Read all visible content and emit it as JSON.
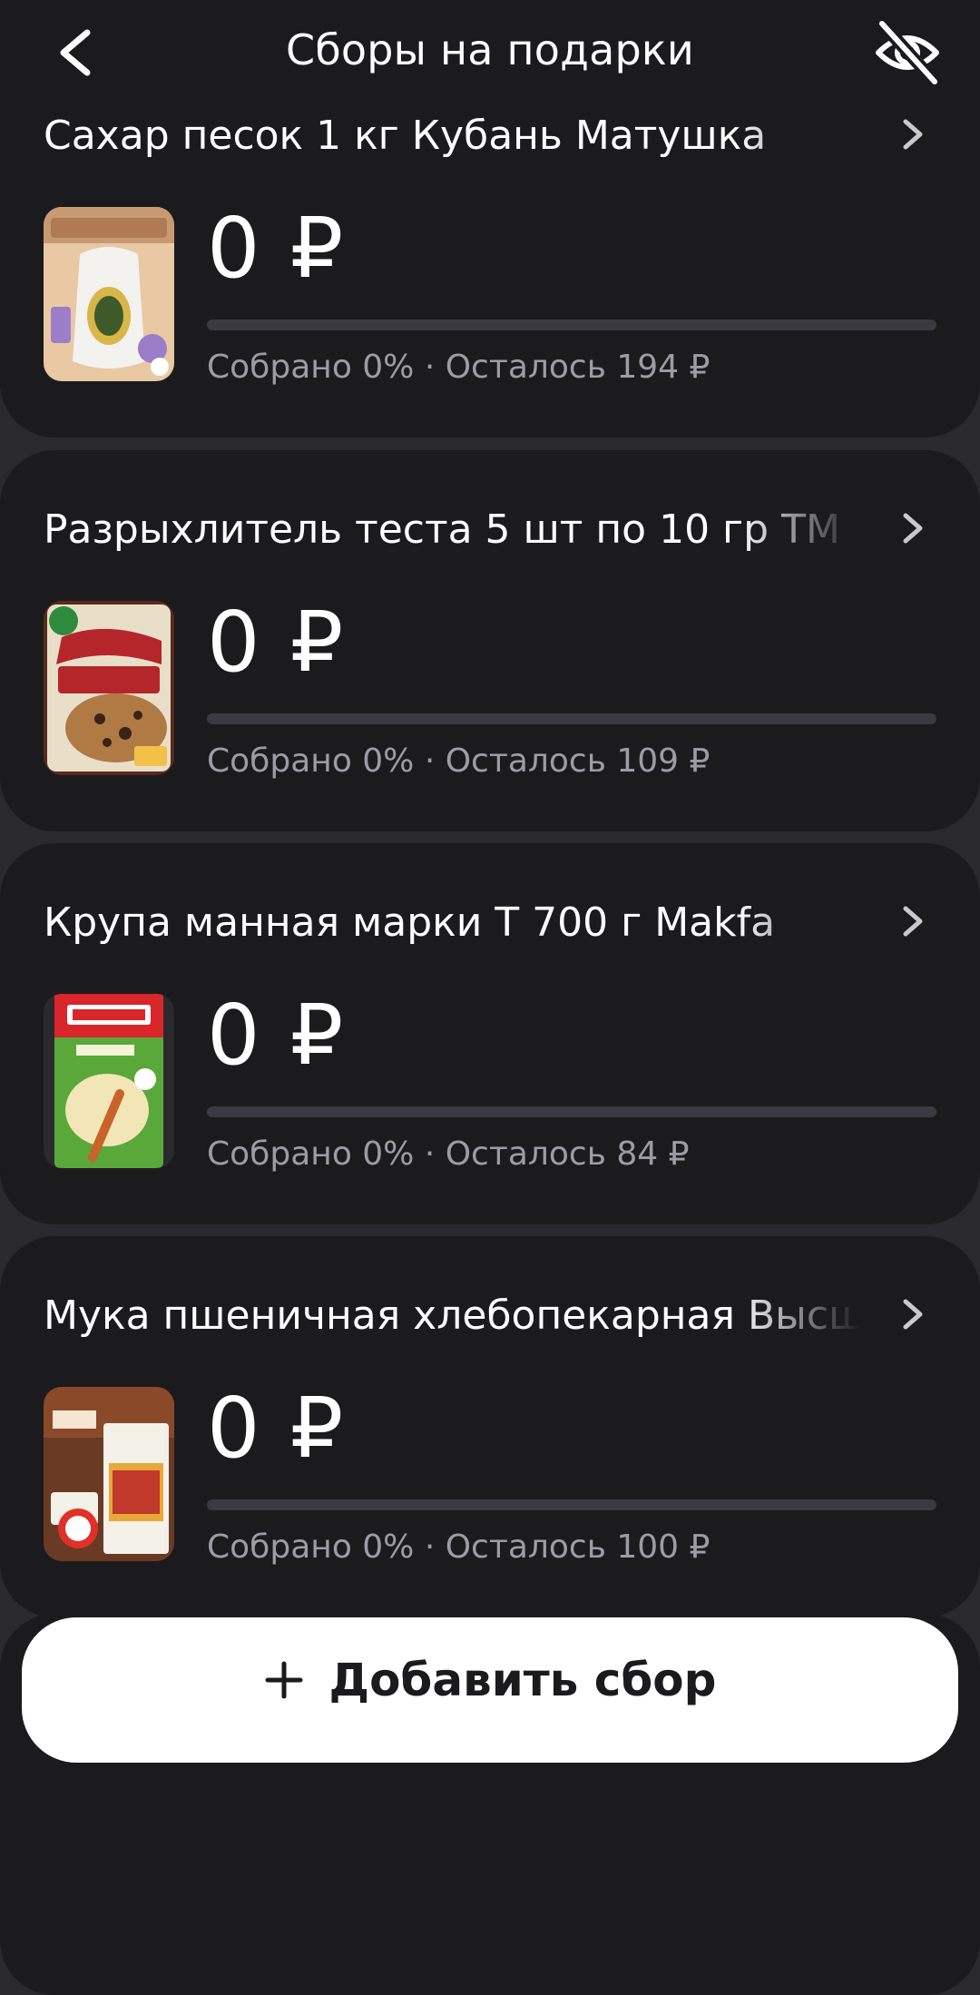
{
  "header": {
    "title": "Сборы на подарки"
  },
  "items": [
    {
      "title": "Сахар песок 1 кг Кубань Матушка",
      "amount": "0 ₽",
      "progress": 0,
      "status": "Собрано 0% · Осталось 194 ₽",
      "image": "sugar-pack-thumbnail"
    },
    {
      "title": "Разрыхлитель теста 5 шт по 10 гр ТМ",
      "amount": "0 ₽",
      "progress": 0,
      "status": "Собрано 0% · Осталось 109 ₽",
      "image": "baking-powder-thumbnail"
    },
    {
      "title": "Крупа манная марки Т 700 г Makfa",
      "amount": "0 ₽",
      "progress": 0,
      "status": "Собрано 0% · Осталось 84 ₽",
      "image": "semolina-pack-thumbnail"
    },
    {
      "title": "Мука пшеничная хлебопекарная Высш",
      "amount": "0 ₽",
      "progress": 0,
      "status": "Собрано 0% · Осталось 100 ₽",
      "image": "flour-pack-thumbnail"
    }
  ],
  "add_button": {
    "label": "Добавить сбор"
  },
  "colors": {
    "background": "#2a292e",
    "card": "#1b1b1e",
    "track": "#3b3a40",
    "secondary_text": "#9d9ca4",
    "button": "#ffffff"
  },
  "icons": {
    "back": "chevron-left-icon",
    "hide": "eye-off-icon",
    "item_arrow": "chevron-right-icon",
    "add": "plus-icon"
  }
}
